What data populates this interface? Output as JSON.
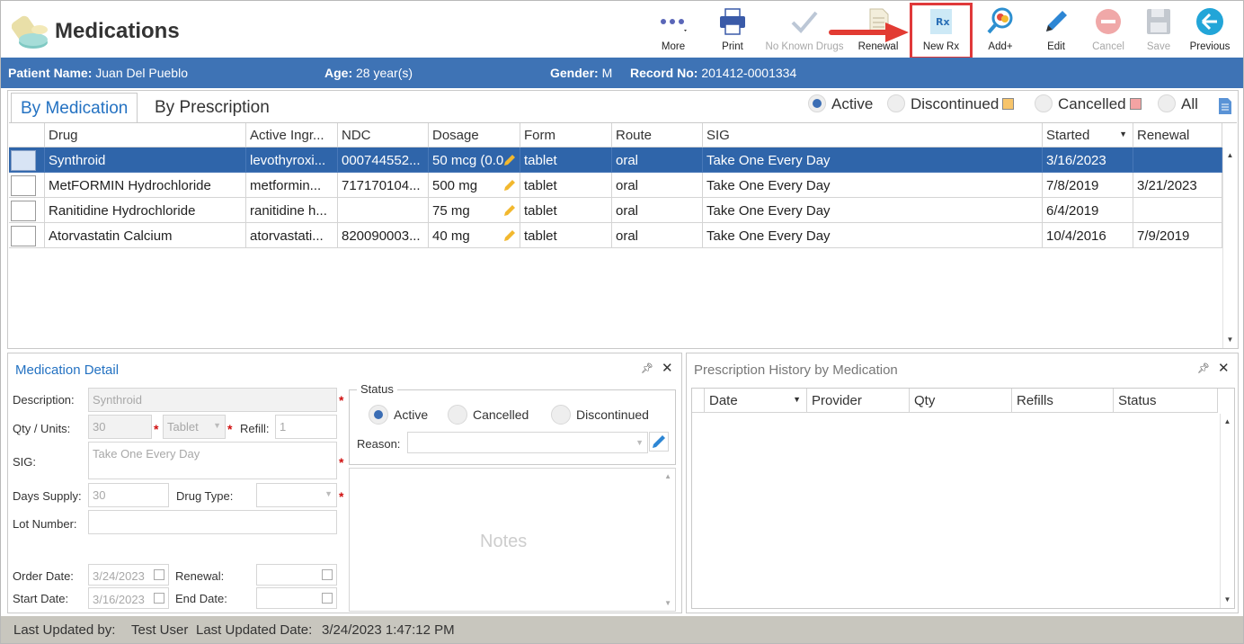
{
  "app": {
    "title": "Medications"
  },
  "toolbar": {
    "more": "More",
    "print": "Print",
    "no_known_drugs": "No Known Drugs",
    "renewal": "Renewal",
    "new_rx": "New Rx",
    "add_plus": "Add+",
    "edit": "Edit",
    "cancel": "Cancel",
    "save": "Save",
    "previous": "Previous",
    "highlighted_button": "New Rx"
  },
  "patient": {
    "name_label": "Patient Name:",
    "name": "Juan Del Pueblo",
    "age_label": "Age:",
    "age": "28 year(s)",
    "gender_label": "Gender:",
    "gender": "M",
    "record_label": "Record No:",
    "record": "201412-0001334"
  },
  "tabs": {
    "by_medication": "By Medication",
    "by_prescription": "By Prescription",
    "active": "By Medication"
  },
  "filters": {
    "active": "Active",
    "discontinued": "Discontinued",
    "cancelled": "Cancelled",
    "all": "All",
    "selected": "Active",
    "discontinued_color": "#f7c46a",
    "cancelled_color": "#f4a3a3"
  },
  "grid": {
    "columns": [
      "Drug",
      "Active Ingr...",
      "NDC",
      "Dosage",
      "Form",
      "Route",
      "SIG",
      "Started",
      "Renewal"
    ],
    "rows": [
      {
        "drug": "Synthroid",
        "ingredient": "levothyroxi...",
        "ndc": "000744552...",
        "dosage": "50 mcg (0.0",
        "form": "tablet",
        "route": "oral",
        "sig": "Take One Every Day",
        "started": "3/16/2023",
        "renewal": "",
        "selected": true
      },
      {
        "drug": "MetFORMIN Hydrochloride",
        "ingredient": "metformin...",
        "ndc": "717170104...",
        "dosage": "500 mg",
        "form": "tablet",
        "route": "oral",
        "sig": "Take One Every Day",
        "started": "7/8/2019",
        "renewal": "3/21/2023",
        "selected": false
      },
      {
        "drug": "Ranitidine Hydrochloride",
        "ingredient": "ranitidine h...",
        "ndc": "",
        "dosage": "75 mg",
        "form": "tablet",
        "route": "oral",
        "sig": "Take One Every Day",
        "started": "6/4/2019",
        "renewal": "",
        "selected": false
      },
      {
        "drug": "Atorvastatin Calcium",
        "ingredient": "atorvastati...",
        "ndc": "820090003...",
        "dosage": "40 mg",
        "form": "tablet",
        "route": "oral",
        "sig": "Take One Every Day",
        "started": "10/4/2016",
        "renewal": "7/9/2019",
        "selected": false
      }
    ]
  },
  "detail": {
    "title": "Medication Detail",
    "description_label": "Description:",
    "description": "Synthroid",
    "qty_label": "Qty / Units:",
    "qty": "30",
    "units": "Tablet",
    "refill_label": "Refill:",
    "refill": "1",
    "sig_label": "SIG:",
    "sig": "Take One Every Day",
    "days_supply_label": "Days Supply:",
    "days_supply": "30",
    "drug_type_label": "Drug Type:",
    "drug_type": "",
    "lot_number_label": "Lot Number:",
    "lot_number": "",
    "order_date_label": "Order Date:",
    "order_date": "3/24/2023",
    "renewal_label": "Renewal:",
    "renewal": "",
    "start_date_label": "Start Date:",
    "start_date": "3/16/2023",
    "end_date_label": "End Date:",
    "end_date": "",
    "status_legend": "Status",
    "status_active": "Active",
    "status_cancelled": "Cancelled",
    "status_discontinued": "Discontinued",
    "status_selected": "Active",
    "reason_label": "Reason:",
    "reason": "",
    "notes_placeholder": "Notes"
  },
  "history": {
    "title": "Prescription History by Medication",
    "columns": [
      "Date",
      "Provider",
      "Qty",
      "Refills",
      "Status"
    ]
  },
  "status_bar": {
    "updated_by_label": "Last Updated by:",
    "updated_by": "Test User",
    "updated_date_label": "Last Updated Date:",
    "updated_date": "3/24/2023 1:47:12 PM"
  }
}
